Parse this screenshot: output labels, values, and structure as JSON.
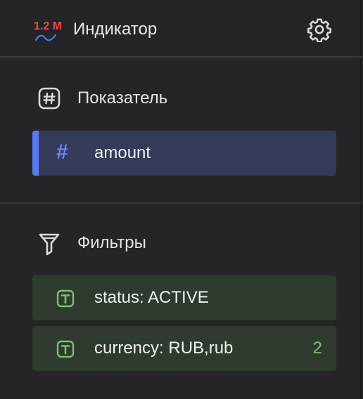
{
  "header": {
    "badge_text": "1.2 M",
    "title": "Индикатор",
    "settings_icon": "gear-icon"
  },
  "measures": {
    "title": "Показатель",
    "icon": "hash-square-icon",
    "items": [
      {
        "glyph": "#",
        "label": "amount"
      }
    ]
  },
  "filters": {
    "title": "Фильтры",
    "icon": "funnel-icon",
    "items": [
      {
        "type_icon": "text-type-icon",
        "label": "status: ACTIVE",
        "count": ""
      },
      {
        "type_icon": "text-type-icon",
        "label": "currency: RUB,rub",
        "count": "2"
      }
    ]
  },
  "colors": {
    "measure_accent": "#5a78f3",
    "measure_bg": "#353a58",
    "filter_bg": "#2f3b2e",
    "filter_icon": "#7bbf73",
    "badge": "#ef4747"
  }
}
